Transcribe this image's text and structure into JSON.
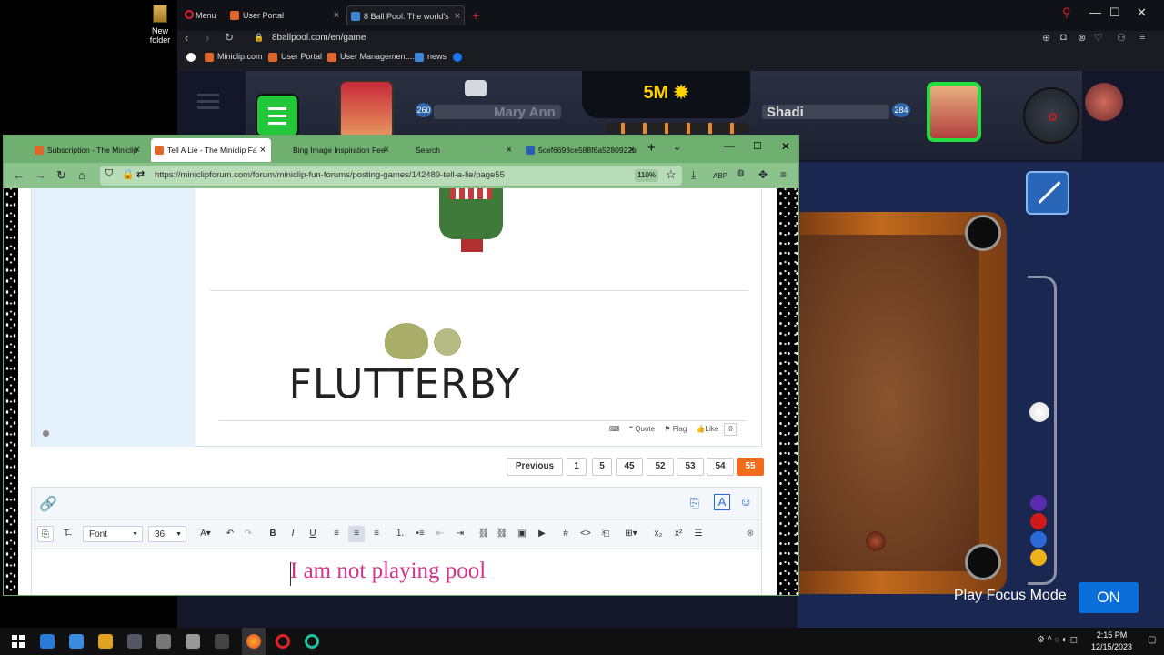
{
  "desktop": {
    "icon_label": "New folder"
  },
  "opera": {
    "menu_label": "Menu",
    "tabs": [
      {
        "label": "User Portal"
      },
      {
        "label": "8 Ball Pool: The world's"
      }
    ],
    "new_tab": "+",
    "close_glyph": "×",
    "url": "8ballpool.com/en/game",
    "bookmarks": [
      "Miniclip.com",
      "User Portal",
      "User Management...",
      "news"
    ]
  },
  "game": {
    "stake": "5M",
    "player_left": {
      "name": "Mary Ann",
      "level": "260"
    },
    "player_right": {
      "name": "Shadi",
      "level": "284"
    },
    "focus_mode_label": "Play Focus Mode",
    "focus_mode_state": "ON"
  },
  "firefox": {
    "tabs": [
      {
        "label": "Subscription - The Miniclip"
      },
      {
        "label": "Tell A Lie - The Miniclip Fa"
      },
      {
        "label": "Bing Image Inspiration Fee"
      },
      {
        "label": "Search"
      },
      {
        "label": "5cef6693ce588f6a5280922b"
      }
    ],
    "url": "https://miniclipforum.com/forum/miniclip-fun-forums/posting-games/142489-tell-a-lie/page55",
    "zoom": "110%",
    "post": {
      "signature_text": "FLUTTERBY",
      "actions": {
        "quote": "Quote",
        "flag": "Flag",
        "like": "Like",
        "like_count": "0"
      }
    },
    "pagination": {
      "previous": "Previous",
      "pages": [
        "1",
        "5",
        "45",
        "52",
        "53",
        "54",
        "55"
      ],
      "active": "55"
    },
    "editor": {
      "font_select": "Font",
      "size_select": "36",
      "content": "I am not playing pool"
    }
  },
  "taskbar": {
    "time": "2:15 PM",
    "date": "12/15/2023"
  },
  "colors": {
    "accent_orange": "#f26a1b",
    "firefox_theme": "#6fb070",
    "focus_button": "#0a6fd8",
    "editor_text": "#d6338a"
  }
}
